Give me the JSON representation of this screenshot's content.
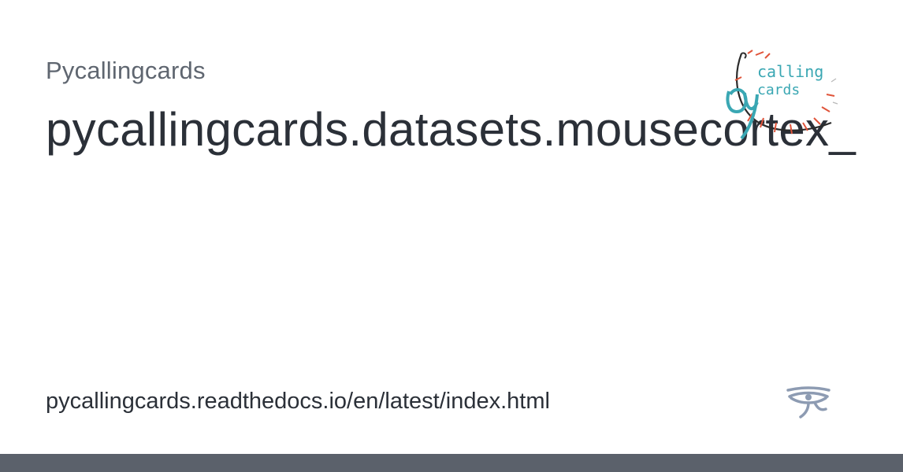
{
  "header": {
    "site_name": "Pycallingcards",
    "page_title": "pycallingcards.datasets.mousecortex_"
  },
  "logo": {
    "line1": "calling",
    "line2": "cards",
    "colors": {
      "teal": "#3aa7b3",
      "red": "#e0543a",
      "dark": "#2b2b2b"
    }
  },
  "footer": {
    "url": "pycallingcards.readthedocs.io/en/latest/index.html",
    "bar_color": "#5b616b"
  },
  "icons": {
    "readthedocs": "eye-of-horus-icon"
  }
}
